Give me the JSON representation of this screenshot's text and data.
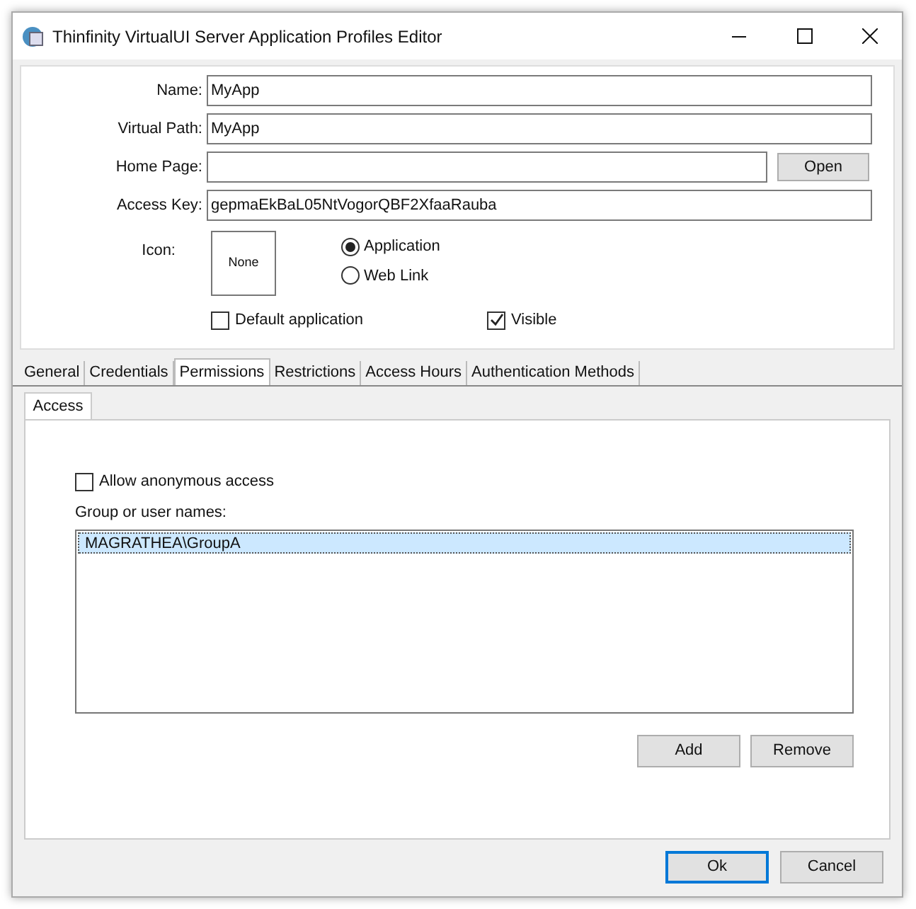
{
  "window": {
    "title": "Thinfinity VirtualUI Server Application Profiles Editor"
  },
  "fields": [
    {
      "label": "Name:",
      "value": "MyApp"
    },
    {
      "label": "Virtual Path:",
      "value": "MyApp"
    },
    {
      "label": "Home Page:",
      "button": "Open"
    },
    {
      "label": "Access Key:",
      "value": "gepmaEkBaL05NtVogorQBF2XfaaRauba"
    }
  ],
  "icon": {
    "label": "Icon:",
    "preview": "None"
  },
  "link_type": [
    {
      "label": "Application",
      "selected": true
    },
    {
      "label": "Web Link",
      "selected": false
    }
  ],
  "options": [
    {
      "label": "Default application",
      "checked": false
    },
    {
      "label": "Visible",
      "checked": true
    }
  ],
  "tabs": [
    {
      "label": "General",
      "selected": false
    },
    {
      "label": "Credentials",
      "selected": false
    },
    {
      "label": "Permissions",
      "selected": true
    },
    {
      "label": "Restrictions",
      "selected": false
    },
    {
      "label": "Access Hours",
      "selected": false
    },
    {
      "label": "Authentication Methods",
      "selected": false
    }
  ],
  "subtabs": [
    {
      "label": "Access",
      "selected": true
    }
  ],
  "anonymous": {
    "label": "Allow anonymous access",
    "checked": false
  },
  "group_list": {
    "label": "Group or user names:",
    "items": [
      {
        "text": "MAGRATHEA\\GroupA",
        "selected": true
      }
    ]
  },
  "list_buttons": [
    "Add",
    "Remove"
  ],
  "dialog_buttons": [
    {
      "label": "Ok",
      "default": true
    },
    {
      "label": "Cancel",
      "default": false
    }
  ]
}
